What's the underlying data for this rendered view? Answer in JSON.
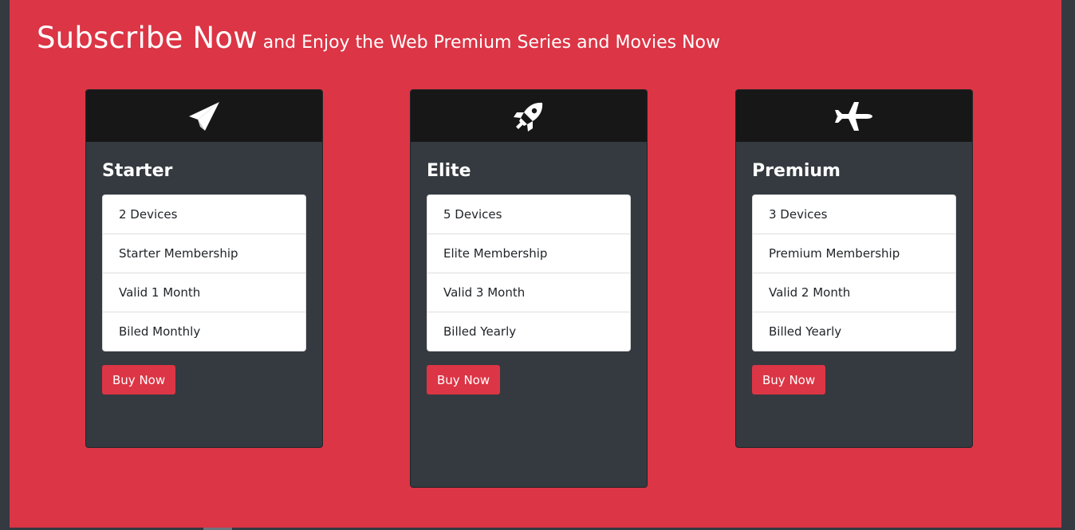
{
  "heading": {
    "big": "Subscribe Now",
    "small": " and Enjoy the Web Premium Series and Movies Now"
  },
  "colors": {
    "background": "#dc3545",
    "card_body": "#343a40",
    "card_header": "#171717",
    "button": "#dc3545"
  },
  "plans": [
    {
      "icon": "paper-plane-icon",
      "title": "Starter",
      "features": [
        "2 Devices",
        "Starter Membership",
        "Valid 1 Month",
        "Biled Monthly"
      ],
      "button_label": "Buy Now"
    },
    {
      "icon": "rocket-icon",
      "title": "Elite",
      "features": [
        "5 Devices",
        "Elite Membership",
        "Valid 3 Month",
        "Billed Yearly"
      ],
      "button_label": "Buy Now"
    },
    {
      "icon": "airplane-icon",
      "title": "Premium",
      "features": [
        "3 Devices",
        "Premium Membership",
        "Valid 2 Month",
        "Billed Yearly"
      ],
      "button_label": "Buy Now"
    }
  ]
}
